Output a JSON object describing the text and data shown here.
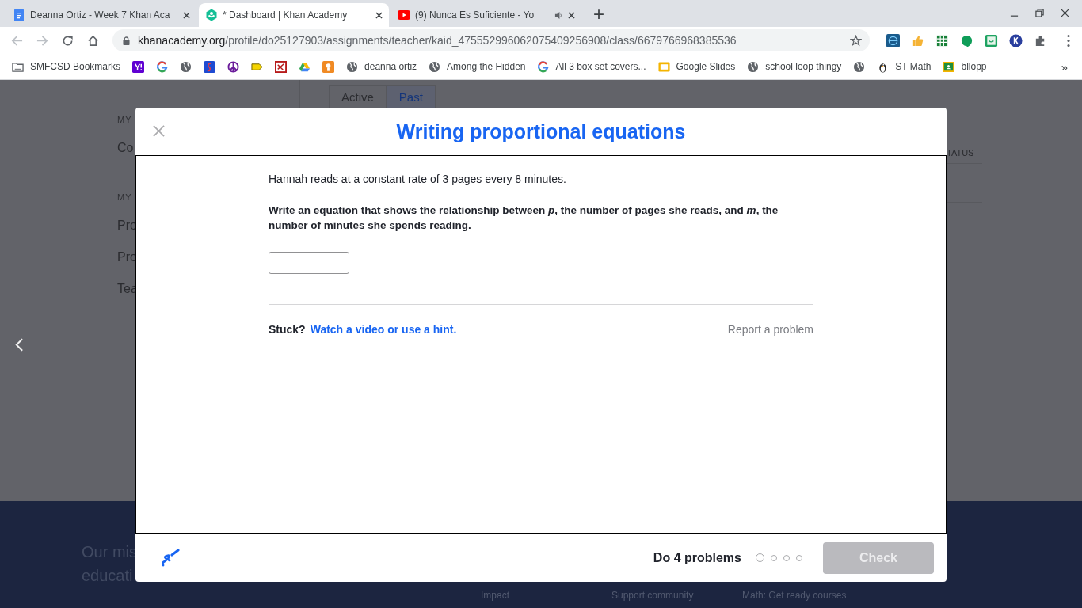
{
  "browser": {
    "tabs": [
      {
        "kind": "docs",
        "title": "Deanna Ortiz - Week 7 Khan Aca",
        "selected": false,
        "audio": false
      },
      {
        "kind": "khan",
        "title": "* Dashboard | Khan Academy",
        "selected": true,
        "audio": false
      },
      {
        "kind": "youtube",
        "title": "(9) Nunca Es Suficiente - Yo",
        "selected": false,
        "audio": true
      }
    ],
    "new_tab": "+",
    "url": {
      "host": "khanacademy.org",
      "path": "/profile/do25127903/assignments/teacher/kaid_475552996062075409256908/class/6679766968385536"
    },
    "extensions": [
      {
        "kind": "globe"
      },
      {
        "kind": "thumb"
      },
      {
        "kind": "sheets"
      },
      {
        "kind": "bubble"
      },
      {
        "kind": "classroom"
      },
      {
        "kind": "k"
      }
    ],
    "bookmarks": [
      {
        "kind": "folder",
        "label": "SMFCSD Bookmarks"
      },
      {
        "kind": "yahoo"
      },
      {
        "kind": "google"
      },
      {
        "kind": "globe"
      },
      {
        "kind": "s"
      },
      {
        "kind": "peace"
      },
      {
        "kind": "tag"
      },
      {
        "kind": "redbox"
      },
      {
        "kind": "drive"
      },
      {
        "kind": "orange"
      },
      {
        "kind": "globe",
        "label": "deanna ortiz"
      },
      {
        "kind": "globe",
        "label": "Among the Hidden"
      },
      {
        "kind": "google",
        "label": "All 3 box set covers..."
      },
      {
        "kind": "slides",
        "label": "Google Slides"
      },
      {
        "kind": "globe",
        "label": "school loop thingy"
      },
      {
        "kind": "globe"
      },
      {
        "kind": "penguin",
        "label": "ST Math"
      },
      {
        "kind": "classroom",
        "label": "bllopp"
      }
    ],
    "more": "»"
  },
  "background_page": {
    "tabs": [
      {
        "label": "Active",
        "selected": false
      },
      {
        "label": "Past",
        "selected": true
      }
    ],
    "sidebar": [
      {
        "kind": "heading",
        "text": "MY"
      },
      {
        "kind": "item",
        "text": "Co"
      },
      {
        "kind": "heading",
        "text": "MY"
      },
      {
        "kind": "item",
        "text": "Pro"
      },
      {
        "kind": "item",
        "text": "Pro"
      },
      {
        "kind": "item",
        "text": "Tea"
      }
    ],
    "column_heading": "TATUS",
    "footer": {
      "mission": [
        "Our mis",
        "educati"
      ],
      "links": [
        "Impact",
        "Support community",
        "Math: Get ready courses"
      ]
    }
  },
  "modal": {
    "title": "Writing proportional equations",
    "problem": "Hannah reads at a constant rate of 3 pages every 8 minutes.",
    "question": "Write an equation that shows the relationship between *p*, the number of pages she reads, and *m*, the number of minutes she spends reading.",
    "stuck": "Stuck?",
    "hint_link": "Watch a video or use a hint.",
    "report": "Report a problem",
    "goal": "Do 4 problems",
    "problems": [
      {
        "current": true
      },
      {
        "current": false
      },
      {
        "current": false
      },
      {
        "current": false
      }
    ],
    "check": {
      "label": "Check",
      "disabled": true
    }
  }
}
